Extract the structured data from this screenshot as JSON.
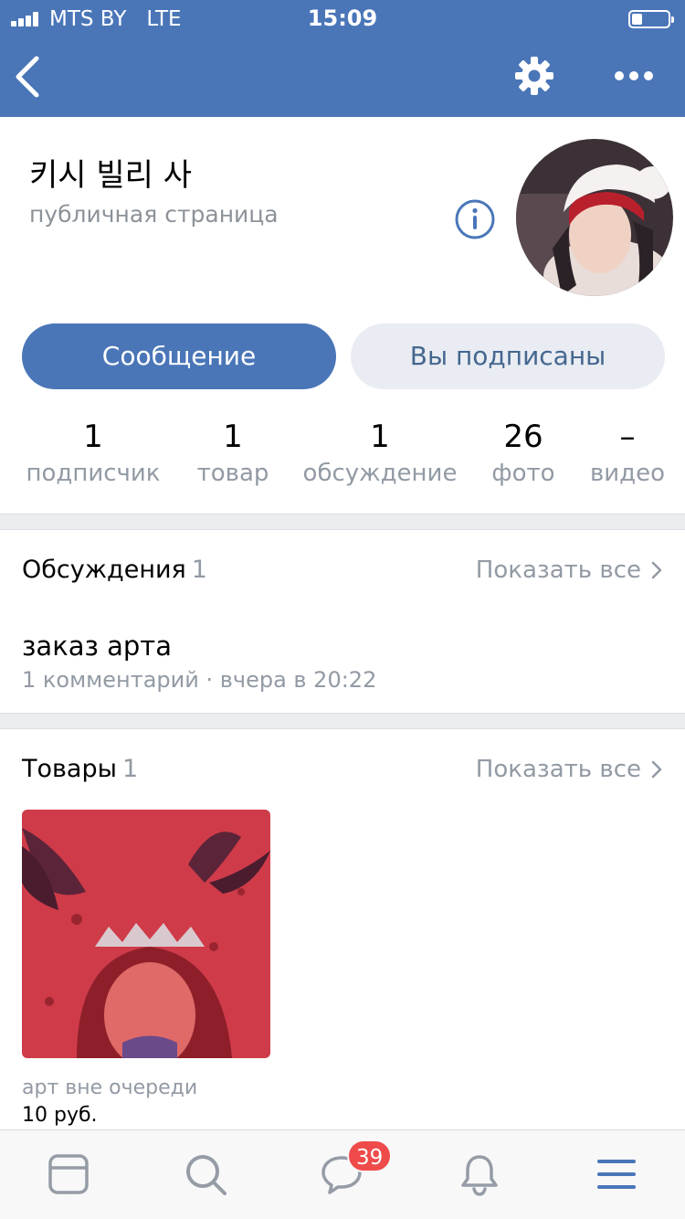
{
  "status_bar": {
    "carrier": "MTS BY",
    "network": "LTE",
    "time": "15:09",
    "battery_level": 0.3
  },
  "nav": {
    "back_icon": "chevron-left-icon",
    "settings_icon": "gear-icon",
    "more_icon": "more-dots-icon"
  },
  "profile": {
    "name": "키시 빌리 사",
    "type": "публичная страница",
    "info_icon": "info-icon"
  },
  "actions": {
    "message_label": "Сообщение",
    "subscribed_label": "Вы подписаны"
  },
  "stats": [
    {
      "value": "1",
      "label": "подписчик"
    },
    {
      "value": "1",
      "label": "товар"
    },
    {
      "value": "1",
      "label": "обсуждение"
    },
    {
      "value": "26",
      "label": "фото"
    },
    {
      "value": "–",
      "label": "видео"
    }
  ],
  "discussions": {
    "title": "Обсуждения",
    "count": "1",
    "show_all": "Показать все",
    "items": [
      {
        "title": "заказ арта",
        "meta": "1 комментарий · вчера в 20:22"
      }
    ]
  },
  "products": {
    "title": "Товары",
    "count": "1",
    "show_all": "Показать все",
    "items": [
      {
        "name": "арт вне очереди",
        "price": "10 руб."
      }
    ]
  },
  "tabbar": {
    "items": [
      "news-icon",
      "search-icon",
      "messages-icon",
      "notifications-icon",
      "menu-icon"
    ],
    "messages_badge": "39"
  },
  "colors": {
    "header": "#4a76b8",
    "accent": "#4a76b8",
    "badge": "#ef4b4b"
  }
}
